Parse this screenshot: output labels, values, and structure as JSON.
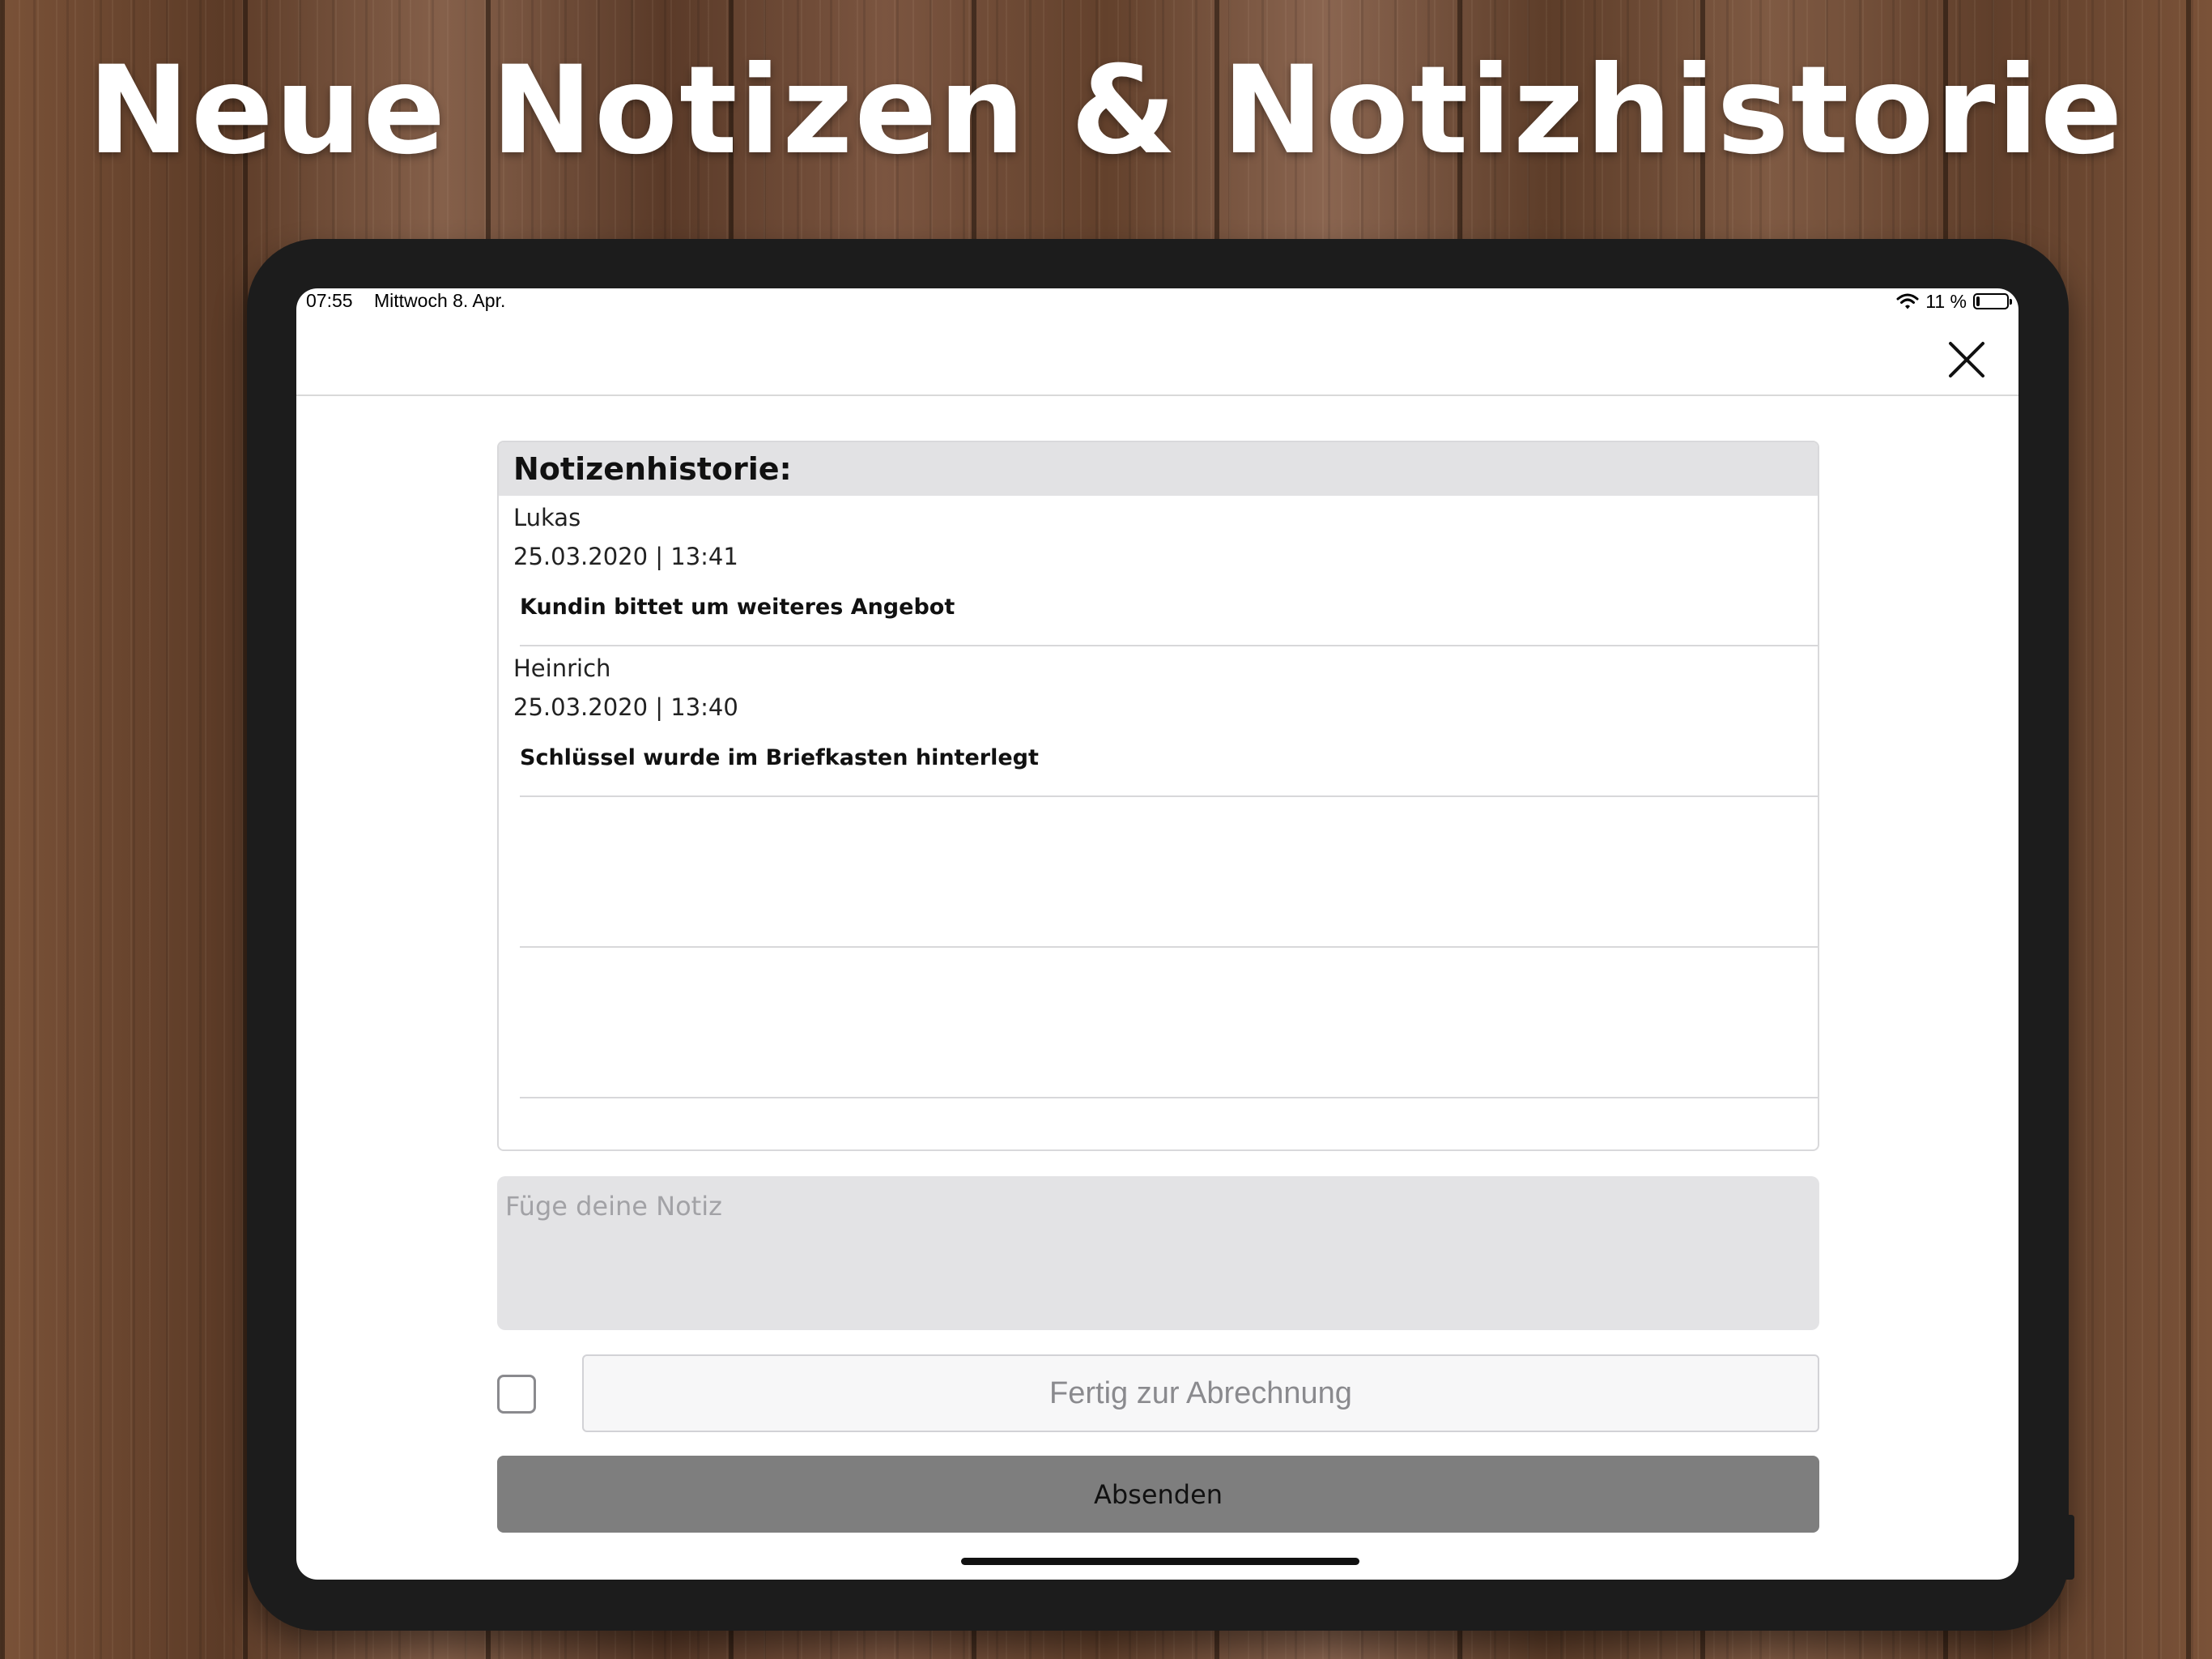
{
  "headline": "Neue Notizen & Notizhistorie",
  "status_bar": {
    "time": "07:55",
    "date": "Mittwoch 8. Apr.",
    "battery_text": "11 %",
    "battery_level": 0.11,
    "icons": [
      "wifi-icon",
      "battery-icon"
    ]
  },
  "modal": {
    "close_icon": "close-icon"
  },
  "history": {
    "title": "Notizenhistorie:",
    "notes": [
      {
        "author": "Lukas",
        "date": "25.03.2020 | 13:41",
        "text": "Kundin bittet um weiteres Angebot"
      },
      {
        "author": "Heinrich",
        "date": "25.03.2020 | 13:40",
        "text": "Schlüssel wurde im Briefkasten hinterlegt"
      },
      {
        "author": "",
        "date": "",
        "text": ""
      },
      {
        "author": "",
        "date": "",
        "text": ""
      }
    ]
  },
  "note_input": {
    "placeholder": "Füge deine Notiz",
    "value": ""
  },
  "billing": {
    "checked": false,
    "label": "Fertig zur Abrechnung"
  },
  "submit": {
    "label": "Absenden"
  },
  "colors": {
    "submit_bg": "#7e7e7e",
    "header_bg": "#e2e2e4",
    "input_bg": "#e3e3e5"
  }
}
